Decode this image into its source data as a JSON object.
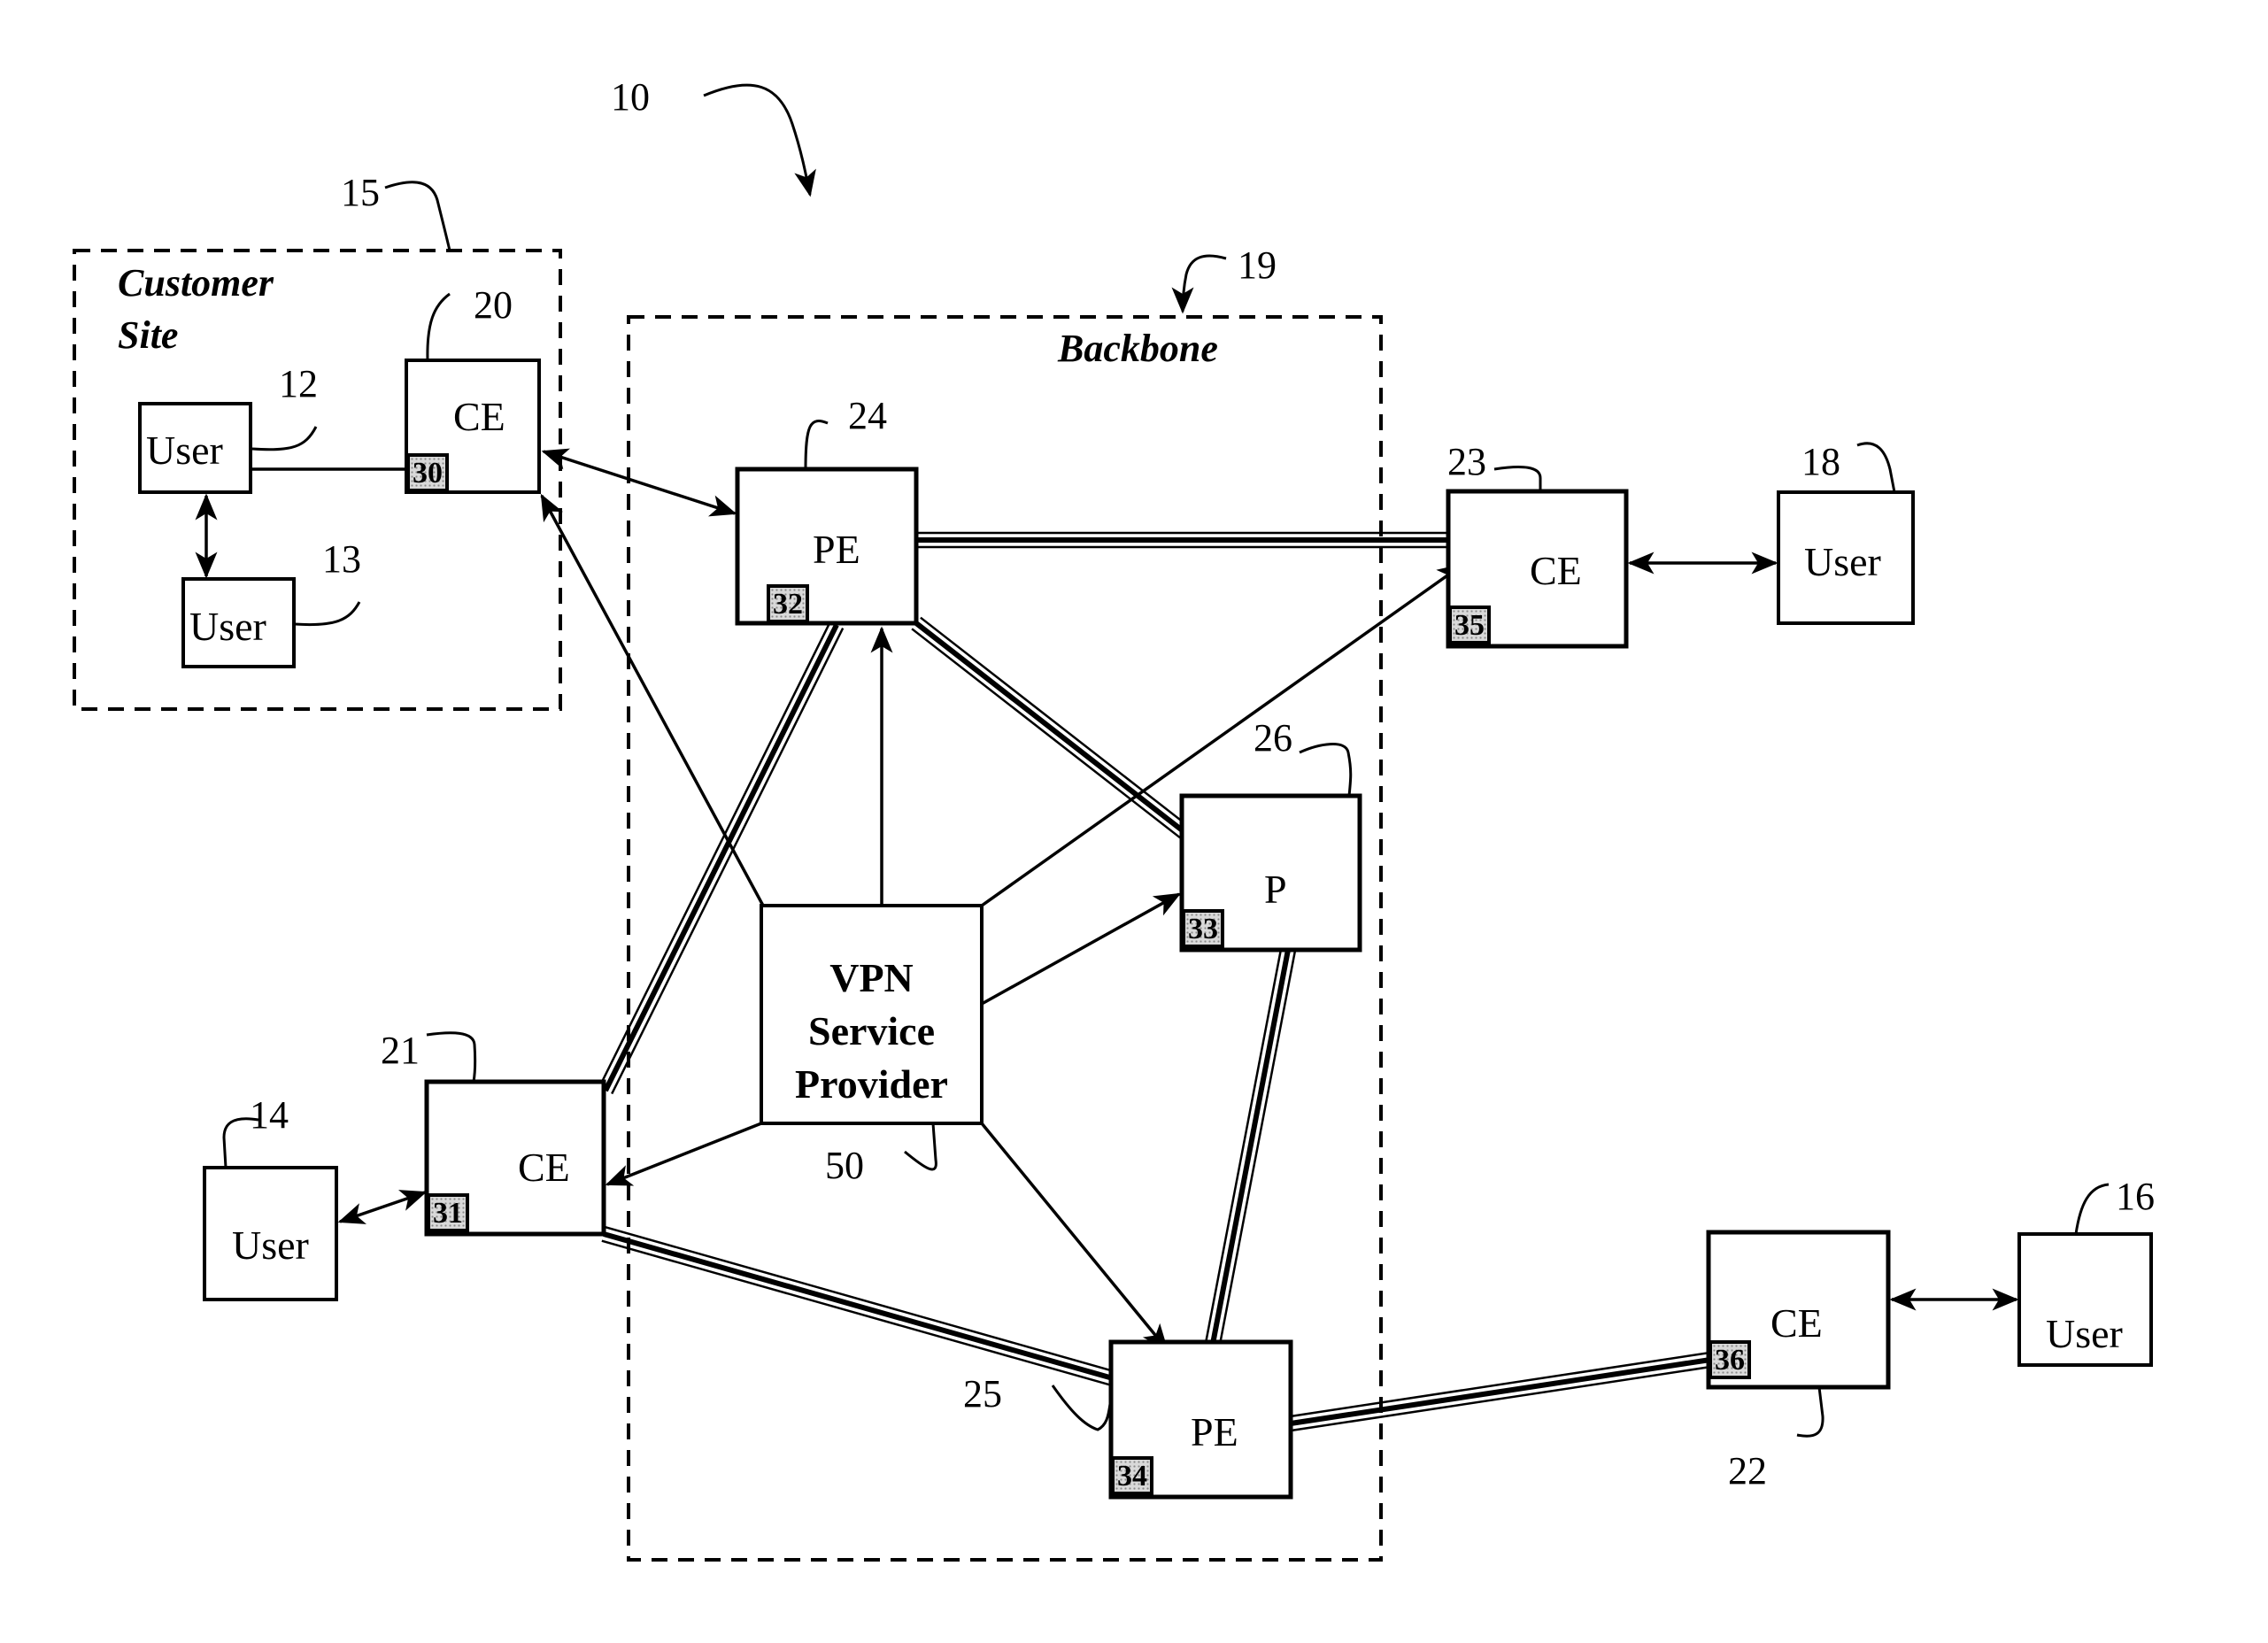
{
  "figure": {
    "reference": "10",
    "groups": {
      "customer_site": {
        "ref": "15",
        "title_line1": "Customer",
        "title_line2": "Site"
      },
      "backbone": {
        "ref": "19",
        "title": "Backbone"
      }
    },
    "nodes": {
      "ce20": {
        "ref": "20",
        "label": "CE",
        "tag": "30"
      },
      "ce21": {
        "ref": "21",
        "label": "CE",
        "tag": "31"
      },
      "ce22": {
        "ref": "22",
        "label": "CE",
        "tag": "36"
      },
      "ce23": {
        "ref": "23",
        "label": "CE",
        "tag": "35"
      },
      "pe24": {
        "ref": "24",
        "label": "PE",
        "tag": "32"
      },
      "pe25": {
        "ref": "25",
        "label": "PE",
        "tag": "34"
      },
      "p26": {
        "ref": "26",
        "label": "P",
        "tag": "33"
      },
      "user12": {
        "ref": "12",
        "label": "User"
      },
      "user13": {
        "ref": "13",
        "label": "User"
      },
      "user14": {
        "ref": "14",
        "label": "User"
      },
      "user16": {
        "ref": "16",
        "label": "User"
      },
      "user18": {
        "ref": "18",
        "label": "User"
      },
      "vpn50": {
        "ref": "50",
        "label_line1": "VPN",
        "label_line2": "Service",
        "label_line3": "Provider"
      }
    },
    "links": {
      "backbone_trunks": [
        "PE24-CE23",
        "PE24-P26",
        "PE24-CE21",
        "P26-PE25",
        "CE21-PE25",
        "PE25-CE22"
      ],
      "control_arrows": [
        "VPN50-PE24",
        "VPN50-CE20",
        "VPN50-CE23",
        "VPN50-P26",
        "VPN50-CE21",
        "VPN50-PE25"
      ],
      "access_links": [
        "CE20-PE24",
        "User12-CE20",
        "User12-User13",
        "User14-CE21",
        "CE23-User18",
        "CE22-User16"
      ]
    }
  }
}
